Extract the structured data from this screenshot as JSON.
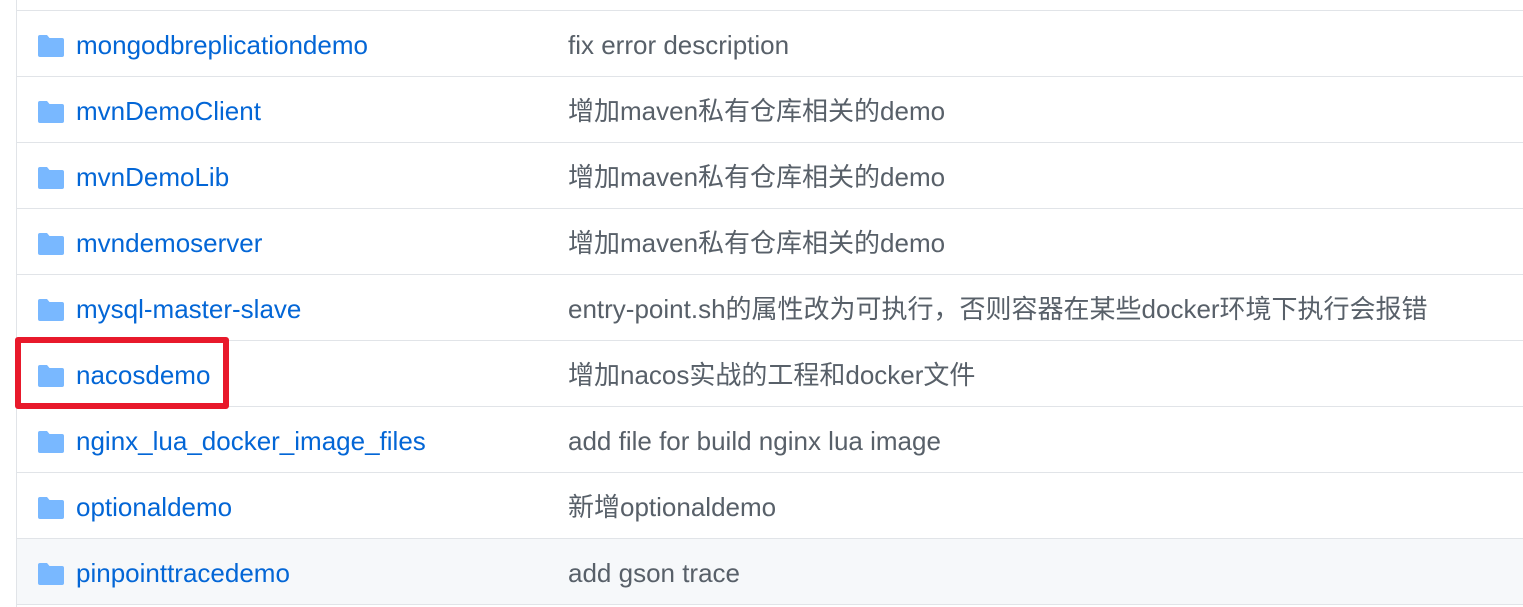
{
  "colors": {
    "link": "#0366d6",
    "message_text": "#586069",
    "folder_icon": "#79b8ff",
    "highlight_box": "#e8192b",
    "row_border": "#e1e4e8"
  },
  "rows": [
    {
      "name": "mongodbreplicationdemo",
      "message": "fix error description",
      "icon": "folder-icon"
    },
    {
      "name": "mvnDemoClient",
      "message": "增加maven私有仓库相关的demo",
      "icon": "folder-icon"
    },
    {
      "name": "mvnDemoLib",
      "message": "增加maven私有仓库相关的demo",
      "icon": "folder-icon"
    },
    {
      "name": "mvndemoserver",
      "message": "增加maven私有仓库相关的demo",
      "icon": "folder-icon"
    },
    {
      "name": "mysql-master-slave",
      "message": "entry-point.sh的属性改为可执行，否则容器在某些docker环境下执行会报错",
      "icon": "folder-icon"
    },
    {
      "name": "nacosdemo",
      "message": "增加nacos实战的工程和docker文件",
      "icon": "folder-icon",
      "highlighted": true
    },
    {
      "name": "nginx_lua_docker_image_files",
      "message": "add file for build nginx lua image",
      "icon": "folder-icon"
    },
    {
      "name": "optionaldemo",
      "message": "新增optionaldemo",
      "icon": "folder-icon"
    },
    {
      "name": "pinpointtracedemo",
      "message": "add gson trace",
      "icon": "folder-icon",
      "hover": true
    }
  ]
}
